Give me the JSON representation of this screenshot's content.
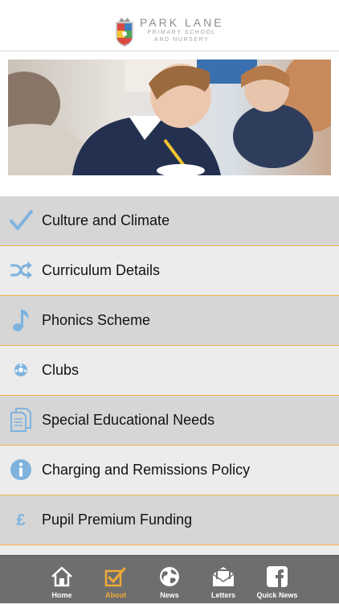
{
  "header": {
    "logo_main": "PARK LANE",
    "logo_sub1": "PRIMARY SCHOOL",
    "logo_sub2": "AND NURSERY"
  },
  "hero": {
    "alt": "Pupils writing at desks"
  },
  "menu": {
    "items": [
      {
        "label": "Culture and Climate",
        "icon": "checkmark-icon"
      },
      {
        "label": "Curriculum Details",
        "icon": "shuffle-icon"
      },
      {
        "label": "Phonics Scheme",
        "icon": "music-note-icon"
      },
      {
        "label": "Clubs",
        "icon": "football-icon"
      },
      {
        "label": "Special Educational Needs",
        "icon": "documents-icon"
      },
      {
        "label": "Charging and Remissions Policy",
        "icon": "info-icon"
      },
      {
        "label": "Pupil Premium Funding",
        "icon": "pound-icon"
      }
    ]
  },
  "tabbar": {
    "tabs": [
      {
        "label": "Home",
        "icon": "home-icon"
      },
      {
        "label": "About",
        "icon": "checkbox-icon",
        "active": true
      },
      {
        "label": "News",
        "icon": "globe-icon"
      },
      {
        "label": "Letters",
        "icon": "mail-icon"
      },
      {
        "label": "Quick News",
        "icon": "facebook-icon"
      }
    ]
  },
  "colors": {
    "accent": "#f0a937",
    "icon_blue": "#7fb3de",
    "divider": "#f0b24a",
    "tabbar": "#6e6e6e"
  }
}
